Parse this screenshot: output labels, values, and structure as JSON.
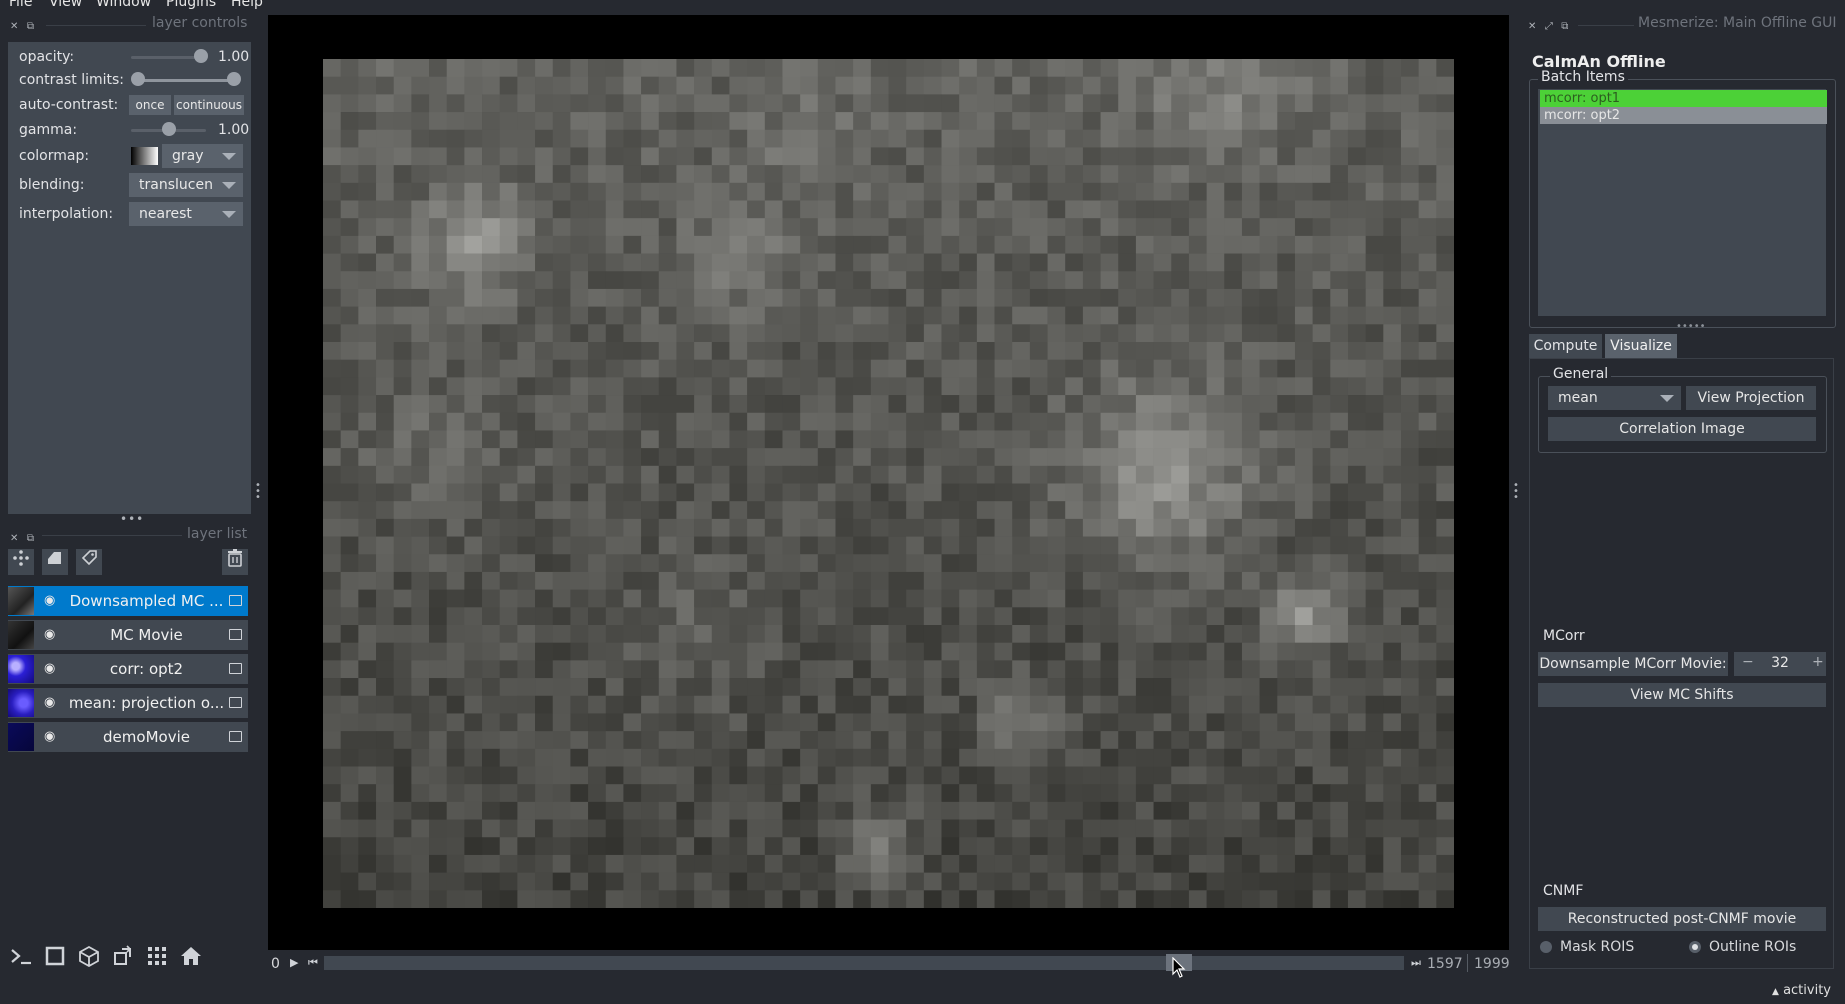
{
  "menu": [
    "File",
    "View",
    "Window",
    "Plugins",
    "Help"
  ],
  "layer_controls": {
    "title": "layer controls",
    "opacity_label": "opacity:",
    "opacity_value": "1.00",
    "opacity_fraction": 1.0,
    "contrast_label": "contrast limits:",
    "autocontrast_label": "auto-contrast:",
    "once_label": "once",
    "continuous_label": "continuous",
    "gamma_label": "gamma:",
    "gamma_value": "1.00",
    "gamma_fraction": 0.5,
    "colormap_label": "colormap:",
    "colormap_value": "gray",
    "blending_label": "blending:",
    "blending_value": "translucen",
    "interpolation_label": "interpolation:",
    "interpolation_value": "nearest"
  },
  "layer_list": {
    "title": "layer list",
    "layers": [
      {
        "name": "Downsampled MC ...",
        "selected": true
      },
      {
        "name": "MC Movie",
        "selected": false
      },
      {
        "name": "corr: opt2",
        "selected": false
      },
      {
        "name": "mean: projection o...",
        "selected": false
      },
      {
        "name": "demoMovie",
        "selected": false
      }
    ]
  },
  "dims": {
    "current": "0",
    "frame": "1597",
    "max": "1999",
    "position_fraction": 0.7989
  },
  "right_panel": {
    "window_title": "Mesmerize: Main Offline GUI",
    "header": "CaImAn Offline",
    "batch_items_title": "Batch Items",
    "batch_items": [
      "mcorr: opt1",
      "mcorr: opt2"
    ],
    "tabs": [
      "Compute",
      "Visualize"
    ],
    "active_tab": "Visualize",
    "general_title": "General",
    "projection_value": "mean",
    "view_projection_label": "View Projection",
    "correlation_label": "Correlation Image",
    "mcorr_title": "MCorr",
    "downsample_label": "Downsample MCorr Movie:",
    "downsample_value": "32",
    "minus": "−",
    "plus": "+",
    "view_shifts_label": "View MC Shifts",
    "cnmf_title": "CNMF",
    "reconstructed_label": "Reconstructed post-CNMF movie",
    "mask_rois_label": "Mask ROIS",
    "outline_rois_label": "Outline ROIs",
    "mask_rois_checked": false,
    "outline_rois_checked": true
  },
  "status": {
    "activity_label": "activity"
  },
  "colors": {
    "background": "#262930",
    "panel": "#414851",
    "selected_layer": "#007acc",
    "batch_item_active": "#4cd137",
    "batch_item_inactive": "#8a8f96"
  }
}
